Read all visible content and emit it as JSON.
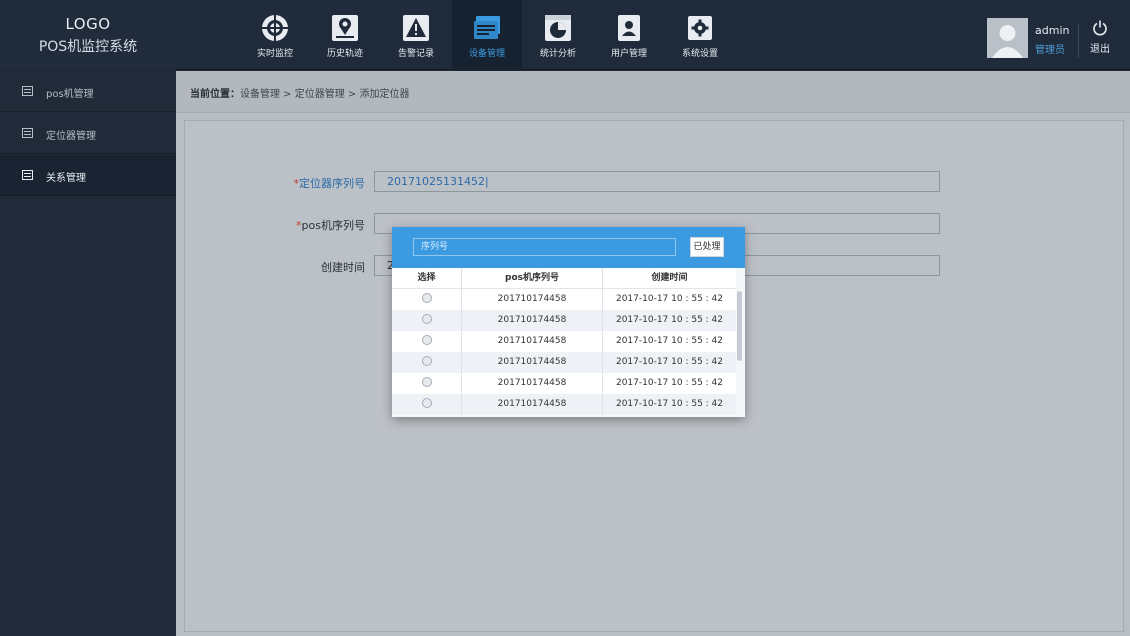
{
  "header": {
    "logo": "LOGO",
    "system_name": "POS机监控系统",
    "nav": [
      {
        "label": "实时监控",
        "icon": "target-icon"
      },
      {
        "label": "历史轨迹",
        "icon": "map-pin-icon"
      },
      {
        "label": "告警记录",
        "icon": "warning-icon"
      },
      {
        "label": "设备管理",
        "icon": "devices-icon",
        "active": true
      },
      {
        "label": "统计分析",
        "icon": "pie-chart-icon"
      },
      {
        "label": "用户管理",
        "icon": "user-card-icon"
      },
      {
        "label": "系统设置",
        "icon": "gear-icon"
      }
    ],
    "user": {
      "name": "admin",
      "role": "管理员"
    },
    "logout_label": "退出"
  },
  "sidebar": {
    "items": [
      {
        "label": "pos机管理",
        "icon": "list-icon"
      },
      {
        "label": "定位器管理",
        "icon": "list-icon"
      },
      {
        "label": "关系管理",
        "icon": "list-icon",
        "active": true
      }
    ]
  },
  "breadcrumb": {
    "prefix": "当前位置：",
    "path": "设备管理 > 定位器管理 > 添加定位器"
  },
  "form": {
    "locator_serial_label": "定位器序列号",
    "locator_serial_value": "20171025131452",
    "pos_serial_label": "pos机序列号",
    "pos_serial_value": "",
    "created_time_label": "创建时间",
    "created_time_value": "2"
  },
  "modal": {
    "search_placeholder": "序列号",
    "processed_button": "已处理",
    "columns": [
      "选择",
      "pos机序列号",
      "创建时间"
    ],
    "rows": [
      {
        "serial": "201710174458",
        "time": "2017-10-17 10 : 55 : 42"
      },
      {
        "serial": "201710174458",
        "time": "2017-10-17 10 : 55 : 42"
      },
      {
        "serial": "201710174458",
        "time": "2017-10-17 10 : 55 : 42"
      },
      {
        "serial": "201710174458",
        "time": "2017-10-17 10 : 55 : 42"
      },
      {
        "serial": "201710174458",
        "time": "2017-10-17 10 : 55 : 42"
      },
      {
        "serial": "201710174458",
        "time": "2017-10-17 10 : 55 : 42"
      }
    ]
  },
  "colors": {
    "accent": "#3c9ae0",
    "header_bg": "#1f2a3a",
    "sidebar_bg": "#202a39",
    "main_bg": "#b9bec4",
    "required_star": "#c0392b"
  }
}
